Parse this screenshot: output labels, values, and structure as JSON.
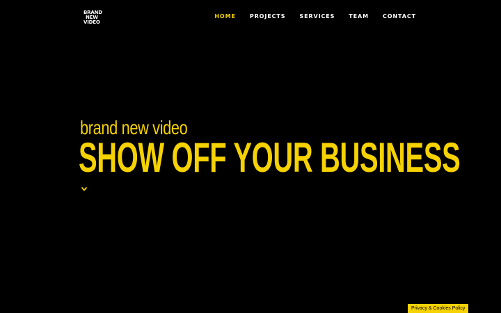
{
  "logo": {
    "line1": "BRAND",
    "line2": "NEW",
    "line3": "VIDEO"
  },
  "nav": {
    "items": [
      {
        "label": "HOME",
        "active": true
      },
      {
        "label": "PROJECTS",
        "active": false
      },
      {
        "label": "SERVICES",
        "active": false
      },
      {
        "label": "TEAM",
        "active": false
      },
      {
        "label": "CONTACT",
        "active": false
      }
    ]
  },
  "hero": {
    "subtitle": "brand new video",
    "headline": "SHOW OFF YOUR BUSINESS",
    "scroll_icon": "chevron-down-icon"
  },
  "footer": {
    "privacy_label": "Privacy & Cookies Policy"
  },
  "colors": {
    "background": "#000000",
    "accent": "#f5d200",
    "nav_text": "#ffffff"
  }
}
